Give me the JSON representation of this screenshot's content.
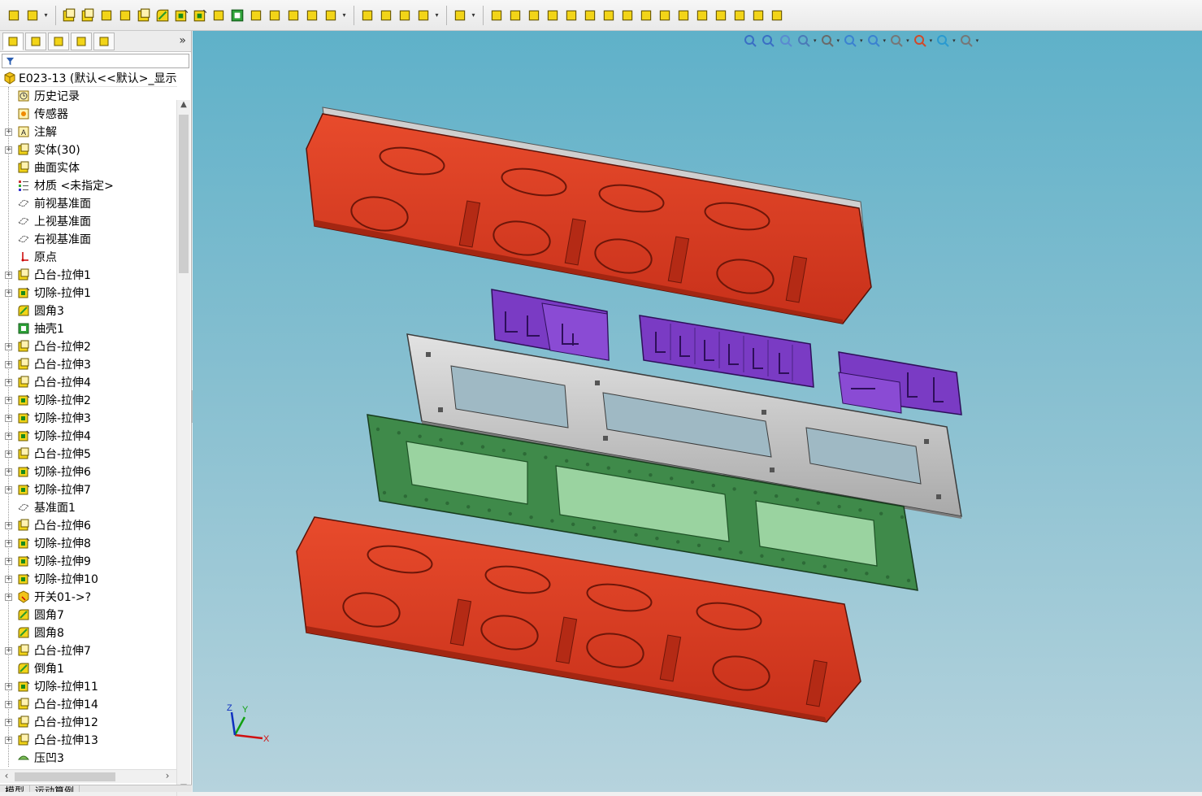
{
  "colors": {
    "viewport_top": "#5fb1c9",
    "viewport_bottom": "#b6d3dd",
    "housing_red": "#d93a22",
    "clip_purple": "#7a3bc4",
    "pcb_green": "#3f8a4a",
    "plate_gray": "#c8c8c8"
  },
  "toolbar": {
    "icons": [
      "new-part-icon",
      "save-icon",
      "extrude-boss-icon",
      "revolve-boss-icon",
      "sweep-icon",
      "loft-icon",
      "boundary-boss-icon",
      "fillet-icon",
      "cut-extrude-icon",
      "cut-revolve-icon",
      "hole-wizard-icon",
      "shell-icon",
      "rib-icon",
      "draft-icon",
      "dome-icon",
      "wrap-icon",
      "intersect-icon",
      "linear-pattern-icon",
      "mirror-icon",
      "reference-geometry-icon",
      "curves-icon",
      "instant3d-icon",
      "sketch-icon",
      "smart-dimension-icon",
      "line-icon",
      "rectangle-icon",
      "slot-icon",
      "circle-icon",
      "polygon-icon",
      "spline-icon",
      "ellipse-icon",
      "offset-icon",
      "point-icon",
      "center-icon",
      "trim-icon",
      "text-icon",
      "mirror-entities-icon",
      "display-relations-icon"
    ]
  },
  "feature_manager": {
    "tabs": [
      "feature-tree-tab",
      "property-manager-tab",
      "configuration-manager-tab",
      "dimxpert-tab",
      "display-manager-tab"
    ],
    "more": "»",
    "root_label": "E023-13  (默认<<默认>_显示",
    "items": [
      {
        "label": "历史记录",
        "icon": "history-icon",
        "expand": false
      },
      {
        "label": "传感器",
        "icon": "sensor-icon",
        "expand": false
      },
      {
        "label": "注解",
        "icon": "annotations-icon",
        "expand": true
      },
      {
        "label": "实体(30)",
        "icon": "solid-bodies-icon",
        "expand": true
      },
      {
        "label": "曲面实体",
        "icon": "surface-bodies-icon",
        "expand": false
      },
      {
        "label": "材质 <未指定>",
        "icon": "material-icon",
        "expand": false
      },
      {
        "label": "前视基准面",
        "icon": "plane-icon",
        "expand": false
      },
      {
        "label": "上视基准面",
        "icon": "plane-icon",
        "expand": false
      },
      {
        "label": "右视基准面",
        "icon": "plane-icon",
        "expand": false
      },
      {
        "label": "原点",
        "icon": "origin-icon",
        "expand": false
      },
      {
        "label": "凸台-拉伸1",
        "icon": "boss-extrude-icon",
        "expand": true
      },
      {
        "label": "切除-拉伸1",
        "icon": "cut-extrude-icon",
        "expand": true
      },
      {
        "label": "圆角3",
        "icon": "fillet-icon",
        "expand": false
      },
      {
        "label": "抽壳1",
        "icon": "shell-icon",
        "expand": false
      },
      {
        "label": "凸台-拉伸2",
        "icon": "boss-extrude-icon",
        "expand": true
      },
      {
        "label": "凸台-拉伸3",
        "icon": "boss-extrude-icon",
        "expand": true
      },
      {
        "label": "凸台-拉伸4",
        "icon": "boss-extrude-icon",
        "expand": true
      },
      {
        "label": "切除-拉伸2",
        "icon": "cut-extrude-icon",
        "expand": true
      },
      {
        "label": "切除-拉伸3",
        "icon": "cut-extrude-icon",
        "expand": true
      },
      {
        "label": "切除-拉伸4",
        "icon": "cut-extrude-icon",
        "expand": true
      },
      {
        "label": "凸台-拉伸5",
        "icon": "boss-extrude-icon",
        "expand": true
      },
      {
        "label": "切除-拉伸6",
        "icon": "cut-extrude-icon",
        "expand": true
      },
      {
        "label": "切除-拉伸7",
        "icon": "cut-extrude-icon",
        "expand": true
      },
      {
        "label": "基准面1",
        "icon": "plane-icon",
        "expand": false
      },
      {
        "label": "凸台-拉伸6",
        "icon": "boss-extrude-icon",
        "expand": true
      },
      {
        "label": "切除-拉伸8",
        "icon": "cut-extrude-icon",
        "expand": true
      },
      {
        "label": "切除-拉伸9",
        "icon": "cut-extrude-icon",
        "expand": true
      },
      {
        "label": "切除-拉伸10",
        "icon": "cut-extrude-icon",
        "expand": true
      },
      {
        "label": "开关01->?",
        "icon": "derived-part-icon",
        "expand": true
      },
      {
        "label": "圆角7",
        "icon": "fillet-icon",
        "expand": false
      },
      {
        "label": "圆角8",
        "icon": "fillet-icon",
        "expand": false
      },
      {
        "label": "凸台-拉伸7",
        "icon": "boss-extrude-icon",
        "expand": true
      },
      {
        "label": "倒角1",
        "icon": "chamfer-icon",
        "expand": false
      },
      {
        "label": "切除-拉伸11",
        "icon": "cut-extrude-icon",
        "expand": true
      },
      {
        "label": "凸台-拉伸14",
        "icon": "boss-extrude-icon",
        "expand": true
      },
      {
        "label": "凸台-拉伸12",
        "icon": "boss-extrude-icon",
        "expand": true
      },
      {
        "label": "凸台-拉伸13",
        "icon": "boss-extrude-icon",
        "expand": true
      },
      {
        "label": "压凹3",
        "icon": "indent-icon",
        "expand": false
      }
    ],
    "bottom_tabs": [
      "模型",
      "运动算例"
    ]
  },
  "view_toolbar": {
    "icons": [
      "zoom-to-fit-icon",
      "zoom-area-icon",
      "previous-view-icon",
      "section-view-icon",
      "dynamic-annotation-icon",
      "view-orientation-icon",
      "display-style-icon",
      "hide-show-icon",
      "edit-appearance-icon",
      "apply-scene-icon",
      "view-settings-icon"
    ]
  },
  "triad": {
    "x": "X",
    "y": "Y",
    "z": "Z"
  }
}
